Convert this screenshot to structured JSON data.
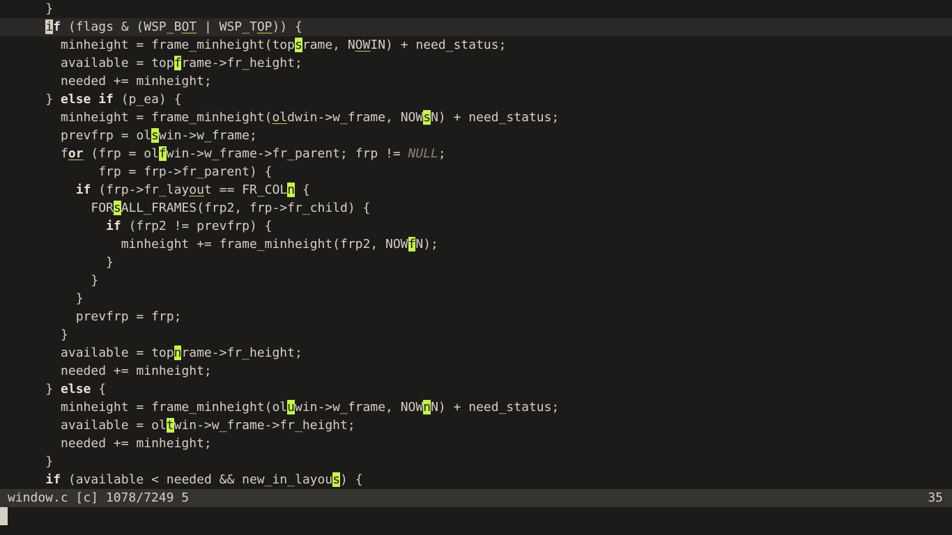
{
  "editor": {
    "lines": [
      [
        {
          "t": "    }"
        }
      ],
      [
        {
          "t": "    "
        },
        {
          "t": "i",
          "c": "cursor"
        },
        {
          "t": "f",
          "c": "kw"
        },
        {
          "t": " (flags & (WSP_B"
        },
        {
          "t": "OT",
          "c": "ul"
        },
        {
          "t": " | WSP_T"
        },
        {
          "t": "OP",
          "c": "ul"
        },
        {
          "t": ")) {"
        }
      ],
      [
        {
          "t": "      minheight = frame_minheight(top"
        },
        {
          "t": "s",
          "c": "hint"
        },
        {
          "t": "rame, N"
        },
        {
          "t": "OW",
          "c": "ul"
        },
        {
          "t": "IN) + need_status;"
        }
      ],
      [
        {
          "t": "      available = top"
        },
        {
          "t": "f",
          "c": "hint"
        },
        {
          "t": "rame->fr_height;"
        }
      ],
      [
        {
          "t": "      needed += minheight;"
        }
      ],
      [
        {
          "t": "    } "
        },
        {
          "t": "else if",
          "c": "kw"
        },
        {
          "t": " (p_ea) {"
        }
      ],
      [
        {
          "t": "      minheight = frame_minheight("
        },
        {
          "t": "ol",
          "c": "ul"
        },
        {
          "t": "dwin->w_frame, NOW"
        },
        {
          "t": "s",
          "c": "hint"
        },
        {
          "t": "N) + need_status;"
        }
      ],
      [
        {
          "t": "      prevfrp = ol"
        },
        {
          "t": "s",
          "c": "hint"
        },
        {
          "t": "win->w_frame;"
        }
      ],
      [
        {
          "t": "      f"
        },
        {
          "t": "or",
          "c": "kw ul"
        },
        {
          "t": " (frp = ol"
        },
        {
          "t": "f",
          "c": "hint"
        },
        {
          "t": "win->w_frame->fr_parent; frp != "
        },
        {
          "t": "NULL",
          "c": "nul"
        },
        {
          "t": ";"
        }
      ],
      [
        {
          "t": "           frp = frp->fr_parent) {"
        }
      ],
      [
        {
          "t": "        "
        },
        {
          "t": "if",
          "c": "kw"
        },
        {
          "t": " (frp->fr_lay"
        },
        {
          "t": "ou",
          "c": "ul"
        },
        {
          "t": "t == FR_COL"
        },
        {
          "t": "n",
          "c": "hint"
        },
        {
          "t": " {"
        }
      ],
      [
        {
          "t": "          FOR"
        },
        {
          "t": "s",
          "c": "hint"
        },
        {
          "t": "ALL_FRAMES(frp2, frp->fr_child) {"
        }
      ],
      [
        {
          "t": "            "
        },
        {
          "t": "if",
          "c": "kw"
        },
        {
          "t": " (frp2 != prevfrp) {"
        }
      ],
      [
        {
          "t": "              minheight += frame_minheight(frp2, NOW"
        },
        {
          "t": "f",
          "c": "hint"
        },
        {
          "t": "N);"
        }
      ],
      [
        {
          "t": "            }"
        }
      ],
      [
        {
          "t": "          }"
        }
      ],
      [
        {
          "t": "        }"
        }
      ],
      [
        {
          "t": "        prevfrp = frp;"
        }
      ],
      [
        {
          "t": "      }"
        }
      ],
      [
        {
          "t": "      available = top"
        },
        {
          "t": "n",
          "c": "hint"
        },
        {
          "t": "rame->fr_height;"
        }
      ],
      [
        {
          "t": "      needed += minheight;"
        }
      ],
      [
        {
          "t": "    } "
        },
        {
          "t": "else",
          "c": "kw"
        },
        {
          "t": " {"
        }
      ],
      [
        {
          "t": "      minheight = frame_minheight(ol"
        },
        {
          "t": "u",
          "c": "hint"
        },
        {
          "t": "win->w_frame, NOW"
        },
        {
          "t": "n",
          "c": "hint"
        },
        {
          "t": "N) + need_status;"
        }
      ],
      [
        {
          "t": "      available = ol"
        },
        {
          "t": "t",
          "c": "hint"
        },
        {
          "t": "win->w_frame->fr_height;"
        }
      ],
      [
        {
          "t": "      needed += minheight;"
        }
      ],
      [
        {
          "t": "    }"
        }
      ],
      [
        {
          "t": "    "
        },
        {
          "t": "if",
          "c": "kw"
        },
        {
          "t": " (available < needed && new_in_layou"
        },
        {
          "t": "s",
          "c": "hint"
        },
        {
          "t": ") {"
        }
      ]
    ],
    "cursor_line_index": 1
  },
  "statusline": {
    "left": "window.c [c] 1078/7249 5",
    "right": "35"
  },
  "cmdline": {
    "text": ""
  }
}
